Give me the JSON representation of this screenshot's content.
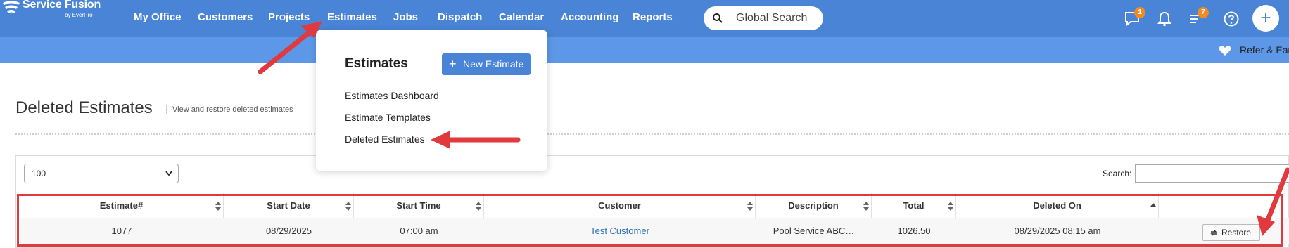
{
  "brand": {
    "name": "Service Fusion",
    "sub": "by EverPro"
  },
  "nav": {
    "items": [
      {
        "label": "My Office"
      },
      {
        "label": "Customers"
      },
      {
        "label": "Projects"
      },
      {
        "label": "Estimates"
      },
      {
        "label": "Jobs"
      },
      {
        "label": "Dispatch"
      },
      {
        "label": "Calendar"
      },
      {
        "label": "Accounting"
      },
      {
        "label": "Reports"
      }
    ],
    "search_placeholder": "Global Search",
    "messages_badge": "1",
    "tasks_badge": "7"
  },
  "subbar": {
    "refer_label": "Refer & Ear"
  },
  "page": {
    "title": "Deleted Estimates",
    "subtitle": "View and restore deleted estimates"
  },
  "dropdown": {
    "title": "Estimates",
    "new_button": "New Estimate",
    "items": [
      {
        "label": "Estimates Dashboard"
      },
      {
        "label": "Estimate Templates"
      },
      {
        "label": "Deleted Estimates"
      }
    ]
  },
  "table_controls": {
    "length_value": "100",
    "search_label": "Search:"
  },
  "table": {
    "columns": [
      "Estimate#",
      "Start Date",
      "Start Time",
      "Customer",
      "Description",
      "Total",
      "Deleted On",
      ""
    ],
    "rows": [
      {
        "estimate": "1077",
        "start_date": "08/29/2025",
        "start_time": "07:00 am",
        "customer": "Test Customer",
        "description": "Pool Service ABC…",
        "total": "1026.50",
        "deleted_on": "08/29/2025 08:15 am",
        "action": "Restore"
      }
    ]
  },
  "colors": {
    "nav_bg": "#4a84d6",
    "subbar_bg": "#5d98e8",
    "highlight": "#e0393e",
    "badge": "#f08a24",
    "link": "#2a6fb5"
  }
}
